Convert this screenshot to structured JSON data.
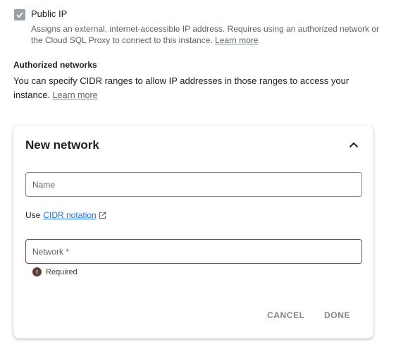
{
  "public_ip": {
    "checked": true,
    "label": "Public IP",
    "description": "Assigns an external, internet-accessible IP address. Requires using an authorized network or the Cloud SQL Proxy to connect to this instance.",
    "learn_more": "Learn more"
  },
  "authorized_networks": {
    "title": "Authorized networks",
    "description": "You can specify CIDR ranges to allow IP addresses in those ranges to access your instance.",
    "learn_more": "Learn more"
  },
  "new_network_card": {
    "title": "New network",
    "name_placeholder": "Name",
    "use_label": "Use",
    "cidr_link": "CIDR notation",
    "network_placeholder": "Network *",
    "required_error": "Required",
    "cancel_label": "CANCEL",
    "done_label": "DONE"
  },
  "icons": {
    "checkbox": "check-icon",
    "collapse": "chevron-up-icon",
    "external_link": "open-in-new-icon",
    "error": "error-icon"
  },
  "colors": {
    "link": "#1a73e8",
    "error_outline": "#7a4a45",
    "muted_text": "#5f6368"
  }
}
